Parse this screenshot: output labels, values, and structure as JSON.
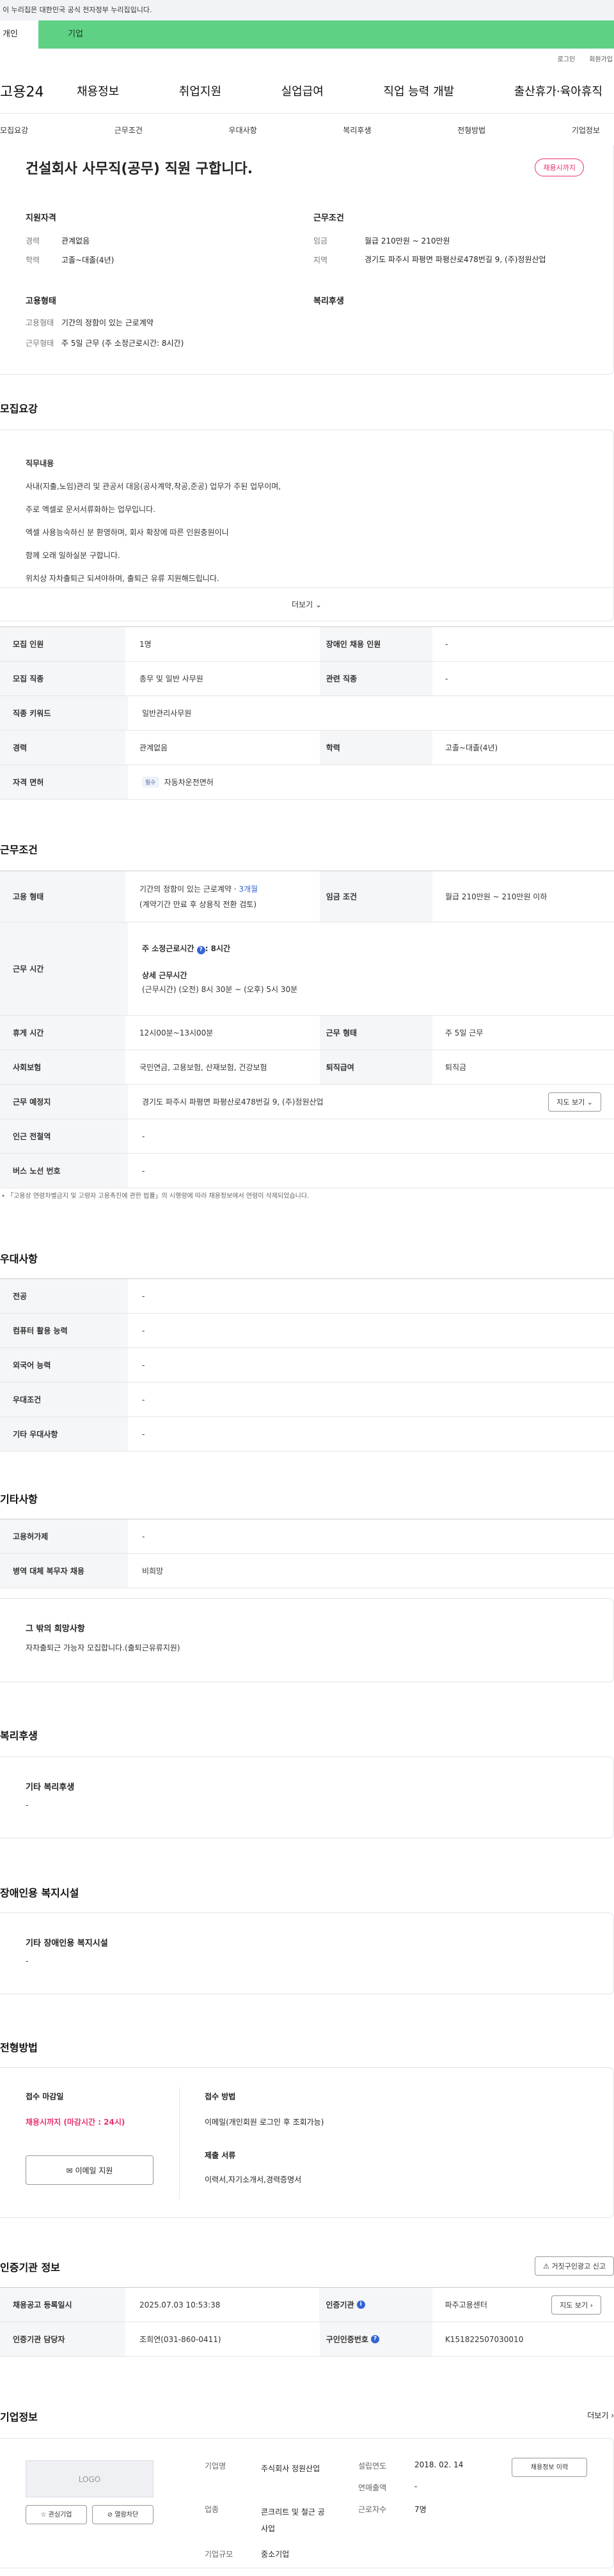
{
  "gov_banner": "이 누리집은 대한민국 공식 전자정부 누리집입니다.",
  "top": {
    "personal": "개인",
    "corporate": "기업"
  },
  "util": {
    "login": "로그인",
    "signup": "회원가입"
  },
  "gnb": {
    "logo": "고용24",
    "menu": [
      "채용정보",
      "취업지원",
      "실업급여",
      "직업 능력 개발",
      "출산휴가·육아휴직"
    ]
  },
  "tabs": [
    "모집요강",
    "근무조건",
    "우대사항",
    "복리후생",
    "전형방법",
    "기업정보"
  ],
  "hero": {
    "title": "건설회사 사무직(공무) 직원 구합니다.",
    "badge": "채용시까지",
    "qual_heading": "지원자격",
    "qual": [
      {
        "k": "경력",
        "v": "관계없음"
      },
      {
        "k": "학력",
        "v": "고졸~대졸(4년)"
      }
    ],
    "emp_heading": "고용형태",
    "emp": [
      {
        "k": "고용형태",
        "v": "기간의 정함이 있는 근로계약"
      },
      {
        "k": "근무형태",
        "v": "주 5일 근무 (주 소정근로시간: 8시간)"
      }
    ],
    "cond_heading": "근무조건",
    "cond": [
      {
        "k": "임금",
        "v": "월급 210만원 ~ 210만원"
      },
      {
        "k": "지역",
        "v": "경기도 파주시 파평면 파평산로478번길 9, (주)정원산업"
      }
    ],
    "welfare_heading": "복리후생"
  },
  "recruit": {
    "title": "모집요강",
    "desc_title": "직무내용",
    "lines": [
      "사내(지출,노임)관리 및 관공서 대응(공사계약,착공,준공) 업무가 주된 업무이며,",
      "주로 엑셀로 문서서류화하는 업무입니다.",
      "엑셀 사용능숙하신 분 환영하며, 회사 확장에 따른 인원충원이니",
      "함께 오래 일하실분 구합니다.",
      "위치상 자차출퇴근 되셔야하며, 출퇴근 유류 지원해드립니다."
    ],
    "more": "더보기",
    "rows": [
      {
        "th": "모집 인원",
        "td": "1명",
        "th2": "장애인 채용 인원",
        "td2": "-"
      },
      {
        "th": "모집 직종",
        "td": "총무 및 일반 사무원",
        "th2": "관련 직종",
        "td2": "-"
      },
      {
        "th": "직종 키워드",
        "td": "일반관리사무원"
      },
      {
        "th": "경력",
        "td": "관계없음",
        "th2": "학력",
        "td2": "고졸~대졸(4년)"
      },
      {
        "th": "자격 면허",
        "pill": "필수",
        "td": "자동차운전면허"
      }
    ]
  },
  "work": {
    "title": "근무조건",
    "emp_th": "고용 형태",
    "emp_td1": "기간의 정함이 있는 근로계약 · ",
    "emp_months": "3개월",
    "emp_td2": "(계약기간 만료 후 상용직 전환 검토)",
    "wage_th": "임금 조건",
    "wage_td": "월급 210만원 ~ 210만원 이하",
    "time_th": "근무 시간",
    "time_main": "주 소정근로시간",
    "time_hours": ": 8시간",
    "time_detail_title": "상세 근무시간",
    "time_detail": "(근무시간) (오전) 8시 30분 ~ (오후) 5시 30분",
    "rest_th": "휴게 시간",
    "rest_td": "12시00분~13시00분",
    "worktype_th": "근무 형태",
    "worktype_td": "주 5일 근무",
    "ins_th": "사회보험",
    "ins_td": "국민연금, 고용보험, 산재보험, 건강보험",
    "ret_th": "퇴직급여",
    "ret_td": "퇴직금",
    "place_th": "근무 예정지",
    "place_td": "경기도 파주시 파평면 파평산로478번길 9, (주)정원산업",
    "map_btn": "지도 보기",
    "subway_th": "인근 전철역",
    "subway_td": "-",
    "bus_th": "버스 노선 번호",
    "bus_td": "-",
    "note": "「고용상 연령차별금지 및 고령자 고용촉진에 관한 법률」의 시행령에 따라 채용정보에서 연령이 삭제되었습니다."
  },
  "pref": {
    "title": "우대사항",
    "rows": [
      {
        "th": "전공",
        "td": "-"
      },
      {
        "th": "컴퓨터 활용 능력",
        "td": "-"
      },
      {
        "th": "외국어 능력",
        "td": "-"
      },
      {
        "th": "우대조건",
        "td": "-"
      },
      {
        "th": "기타 우대사항",
        "td": "-"
      }
    ]
  },
  "etc": {
    "title": "기타사항",
    "rows": [
      {
        "th": "고용허가제",
        "td": "-"
      },
      {
        "th": "병역 대체 복무자 채용",
        "td": "비희망"
      }
    ],
    "wish_title": "그 밖의 희망사항",
    "wish_text": "자차출퇴근 가능자 모집합니다.(출퇴근유류지원)"
  },
  "welfare": {
    "title": "복리후생",
    "box_title": "기타 복리후생",
    "box_text": "-"
  },
  "disab": {
    "title": "장애인용 복지시설",
    "box_title": "기타 장애인용 복지시설",
    "box_text": "-"
  },
  "selection": {
    "title": "전형방법",
    "deadline_label": "접수 마감일",
    "deadline": "채용시까지 (마감시간 : 24시)",
    "email_btn": "이메일 지원",
    "method_label": "접수 방법",
    "method": "이메일(개인회원 로그인 후 조회가능)",
    "docs_label": "제출 서류",
    "docs": "이력서,자기소개서,경력증명서"
  },
  "cert": {
    "title": "인증기관 정보",
    "report_btn": "거짓구인광고 신고",
    "rows": [
      {
        "th": "채용공고 등록일시",
        "td": "2025.07.03 10:53:38",
        "th2": "인증기관",
        "td2": "파주고용센터",
        "btn": "지도 보기"
      },
      {
        "th": "인증기관 담당자",
        "td": "조희연(031-860-0411)",
        "th2": "구인인증번호",
        "td2": "K151822507030010"
      }
    ]
  },
  "company": {
    "title": "기업정보",
    "more": "더보기",
    "logo": "LOGO",
    "fav_btn": "관심기업",
    "block_btn": "열람차단",
    "items": [
      {
        "k": "기업명",
        "v": "주식회사 정원산업"
      },
      {
        "k": "업종",
        "v": "콘크리트 및 철근 공사업"
      },
      {
        "k": "기업규모",
        "v": "중소기업"
      }
    ],
    "items2": [
      {
        "k": "설립연도",
        "v": "2018. 02. 14"
      },
      {
        "k": "연매출액",
        "v": "-"
      },
      {
        "k": "근로자수",
        "v": "7명"
      }
    ],
    "history_btn": "채용정보 이력"
  }
}
